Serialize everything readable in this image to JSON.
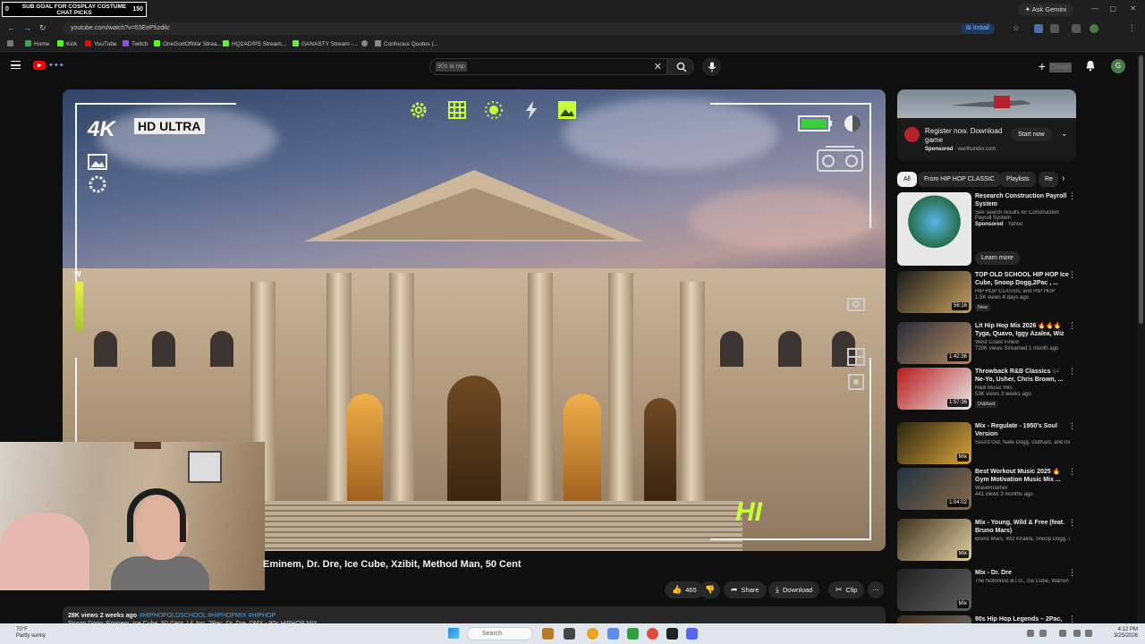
{
  "overlay": {
    "banner_line1": "SUB GOAL FOR COSPLAY COSTUME",
    "banner_line2": "CHAT PICKS",
    "banner_left": "0",
    "banner_count": "150"
  },
  "browser": {
    "ask_gemini": "Ask Gemini",
    "url": "youtube.com/watch?v=53EeP5zdilc",
    "install": "Install",
    "bookmarks": [
      {
        "label": "Home",
        "color": "#34a853"
      },
      {
        "label": "Kick",
        "color": "#53fc18"
      },
      {
        "label": "YouTube",
        "color": "#ff0000"
      },
      {
        "label": "Twitch",
        "color": "#9146ff"
      },
      {
        "label": "OneGodOfWar Strea...",
        "color": "#53fc18"
      },
      {
        "label": "HQ2AD!PS Stream...",
        "color": "#53fc18"
      },
      {
        "label": "GANASTY Stream -...",
        "color": "#53fc18"
      },
      {
        "label": "Confucius Quotes (...",
        "color": "#888888"
      }
    ]
  },
  "youtube": {
    "search_query": "90s ai rap",
    "create_label": "Create",
    "avatar_letter": "G"
  },
  "video": {
    "title": "Eminem, Dr. Dre, Ice Cube, Xzibit, Method Man, 50 Cent",
    "hud_4k": "4K",
    "hud_hd": "HD ULTRA",
    "hud_w": "W",
    "hud_hi": "HI",
    "likes": "465",
    "share": "Share",
    "download": "Download",
    "clip": "Clip",
    "views_date": "28K views  2 weeks ago",
    "hashtags": "#HIPHOPOLDSCHOOL #HIPHOPMIX #HIPHOP",
    "desc_line2": "Snoop Dogg, Eminem, Ice Cube, 50 Cent, Lil Jon, 2Pac, Dr. Dre, DMX - 90s HIPHOP MIX"
  },
  "ad": {
    "title": "Register now. Download game",
    "sponsored": "Sponsored",
    "domain": "warthunder.com",
    "cta": "Start now"
  },
  "chips": [
    "All",
    "From HIP HOP CLASSIC",
    "Playlists",
    "Re"
  ],
  "ad_rec": {
    "title": "Research Construction Payroll System",
    "sub": "See search results for Construction Payroll System",
    "sponsored": "Sponsored",
    "source": "Yahoo",
    "cta": "Learn more"
  },
  "recommendations": [
    {
      "title": "TOP OLD SCHOOL HIP HOP Ice Cube, Snoop Dogg,2Pac , ...",
      "channel": "HIP HOP CLASSIC and HIP HOP",
      "views": "1.5K views  4 days ago",
      "badge": "New",
      "duration": "56:16",
      "c1": "#1a1a1a",
      "c2": "#c9a060"
    },
    {
      "title": "Lit Hip Hop Mix 2026 🔥🔥🔥 Tyga, Quavo, Iggy Azalea, Wiz ...",
      "channel": "West Coast Finest",
      "views": "720K views  Streamed 1 month ago",
      "badge": "",
      "duration": "1:42:36",
      "c1": "#2a2a3a",
      "c2": "#b08b60"
    },
    {
      "title": "Throwback R&B Classics 🎶 Ne-Yo, Usher, Chris Brown, ...",
      "channel": "R&B Music Hits",
      "views": "53K views  3 weeks ago",
      "badge": "Dubbed",
      "duration": "1:57:36",
      "c1": "#b81a1a",
      "c2": "#e9e9e9"
    },
    {
      "title": "Mix - Regulate - 1950's Soul Version",
      "channel": "Soul'd Out, Nate Dogg, OutKast, and more",
      "views": "",
      "badge": "",
      "duration": "Mix",
      "c1": "#2b2410",
      "c2": "#d9a43a"
    },
    {
      "title": "Best Workout Music 2025 🔥 Gym Motivation Music Mix ...",
      "channel": "WaveRoamer",
      "views": "441 views  3 months ago",
      "badge": "",
      "duration": "1:04:02",
      "c1": "#1f3140",
      "c2": "#8a6a4a"
    },
    {
      "title": "Mix - Young, Wild & Free (feat. Bruno Mars)",
      "channel": "Bruno Mars, Wiz Khalifa, Snoop Dogg, an...",
      "views": "",
      "badge": "",
      "duration": "Mix",
      "c1": "#3b3020",
      "c2": "#e2cfa0"
    },
    {
      "title": "Mix - Dr. Dre",
      "channel": "The Notorious B.I.G., Ice Cube, Warren G,...",
      "views": "",
      "badge": "",
      "duration": "Mix",
      "c1": "#202020",
      "c2": "#5d5d5d"
    },
    {
      "title": "90s Hip Hop Legends – 2Pac,",
      "channel": "",
      "views": "",
      "badge": "",
      "duration": "",
      "c1": "#3a2a1a",
      "c2": "#777777"
    }
  ],
  "taskbar": {
    "weather_temp": "70°F",
    "weather_desc": "Partly sunny",
    "search": "Search",
    "time": "4:12 PM",
    "date": "3/25/2026"
  }
}
